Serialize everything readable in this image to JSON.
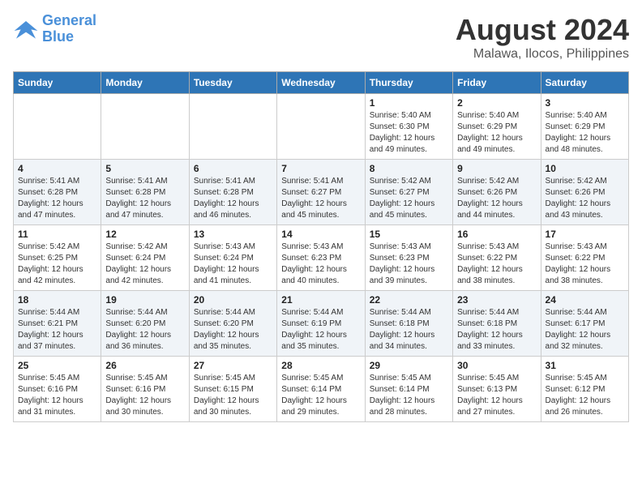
{
  "logo": {
    "line1": "General",
    "line2": "Blue"
  },
  "title": "August 2024",
  "subtitle": "Malawa, Ilocos, Philippines",
  "weekdays": [
    "Sunday",
    "Monday",
    "Tuesday",
    "Wednesday",
    "Thursday",
    "Friday",
    "Saturday"
  ],
  "weeks": [
    [
      {
        "day": "",
        "info": ""
      },
      {
        "day": "",
        "info": ""
      },
      {
        "day": "",
        "info": ""
      },
      {
        "day": "",
        "info": ""
      },
      {
        "day": "1",
        "info": "Sunrise: 5:40 AM\nSunset: 6:30 PM\nDaylight: 12 hours\nand 49 minutes."
      },
      {
        "day": "2",
        "info": "Sunrise: 5:40 AM\nSunset: 6:29 PM\nDaylight: 12 hours\nand 49 minutes."
      },
      {
        "day": "3",
        "info": "Sunrise: 5:40 AM\nSunset: 6:29 PM\nDaylight: 12 hours\nand 48 minutes."
      }
    ],
    [
      {
        "day": "4",
        "info": "Sunrise: 5:41 AM\nSunset: 6:28 PM\nDaylight: 12 hours\nand 47 minutes."
      },
      {
        "day": "5",
        "info": "Sunrise: 5:41 AM\nSunset: 6:28 PM\nDaylight: 12 hours\nand 47 minutes."
      },
      {
        "day": "6",
        "info": "Sunrise: 5:41 AM\nSunset: 6:28 PM\nDaylight: 12 hours\nand 46 minutes."
      },
      {
        "day": "7",
        "info": "Sunrise: 5:41 AM\nSunset: 6:27 PM\nDaylight: 12 hours\nand 45 minutes."
      },
      {
        "day": "8",
        "info": "Sunrise: 5:42 AM\nSunset: 6:27 PM\nDaylight: 12 hours\nand 45 minutes."
      },
      {
        "day": "9",
        "info": "Sunrise: 5:42 AM\nSunset: 6:26 PM\nDaylight: 12 hours\nand 44 minutes."
      },
      {
        "day": "10",
        "info": "Sunrise: 5:42 AM\nSunset: 6:26 PM\nDaylight: 12 hours\nand 43 minutes."
      }
    ],
    [
      {
        "day": "11",
        "info": "Sunrise: 5:42 AM\nSunset: 6:25 PM\nDaylight: 12 hours\nand 42 minutes."
      },
      {
        "day": "12",
        "info": "Sunrise: 5:42 AM\nSunset: 6:24 PM\nDaylight: 12 hours\nand 42 minutes."
      },
      {
        "day": "13",
        "info": "Sunrise: 5:43 AM\nSunset: 6:24 PM\nDaylight: 12 hours\nand 41 minutes."
      },
      {
        "day": "14",
        "info": "Sunrise: 5:43 AM\nSunset: 6:23 PM\nDaylight: 12 hours\nand 40 minutes."
      },
      {
        "day": "15",
        "info": "Sunrise: 5:43 AM\nSunset: 6:23 PM\nDaylight: 12 hours\nand 39 minutes."
      },
      {
        "day": "16",
        "info": "Sunrise: 5:43 AM\nSunset: 6:22 PM\nDaylight: 12 hours\nand 38 minutes."
      },
      {
        "day": "17",
        "info": "Sunrise: 5:43 AM\nSunset: 6:22 PM\nDaylight: 12 hours\nand 38 minutes."
      }
    ],
    [
      {
        "day": "18",
        "info": "Sunrise: 5:44 AM\nSunset: 6:21 PM\nDaylight: 12 hours\nand 37 minutes."
      },
      {
        "day": "19",
        "info": "Sunrise: 5:44 AM\nSunset: 6:20 PM\nDaylight: 12 hours\nand 36 minutes."
      },
      {
        "day": "20",
        "info": "Sunrise: 5:44 AM\nSunset: 6:20 PM\nDaylight: 12 hours\nand 35 minutes."
      },
      {
        "day": "21",
        "info": "Sunrise: 5:44 AM\nSunset: 6:19 PM\nDaylight: 12 hours\nand 35 minutes."
      },
      {
        "day": "22",
        "info": "Sunrise: 5:44 AM\nSunset: 6:18 PM\nDaylight: 12 hours\nand 34 minutes."
      },
      {
        "day": "23",
        "info": "Sunrise: 5:44 AM\nSunset: 6:18 PM\nDaylight: 12 hours\nand 33 minutes."
      },
      {
        "day": "24",
        "info": "Sunrise: 5:44 AM\nSunset: 6:17 PM\nDaylight: 12 hours\nand 32 minutes."
      }
    ],
    [
      {
        "day": "25",
        "info": "Sunrise: 5:45 AM\nSunset: 6:16 PM\nDaylight: 12 hours\nand 31 minutes."
      },
      {
        "day": "26",
        "info": "Sunrise: 5:45 AM\nSunset: 6:16 PM\nDaylight: 12 hours\nand 30 minutes."
      },
      {
        "day": "27",
        "info": "Sunrise: 5:45 AM\nSunset: 6:15 PM\nDaylight: 12 hours\nand 30 minutes."
      },
      {
        "day": "28",
        "info": "Sunrise: 5:45 AM\nSunset: 6:14 PM\nDaylight: 12 hours\nand 29 minutes."
      },
      {
        "day": "29",
        "info": "Sunrise: 5:45 AM\nSunset: 6:14 PM\nDaylight: 12 hours\nand 28 minutes."
      },
      {
        "day": "30",
        "info": "Sunrise: 5:45 AM\nSunset: 6:13 PM\nDaylight: 12 hours\nand 27 minutes."
      },
      {
        "day": "31",
        "info": "Sunrise: 5:45 AM\nSunset: 6:12 PM\nDaylight: 12 hours\nand 26 minutes."
      }
    ]
  ]
}
